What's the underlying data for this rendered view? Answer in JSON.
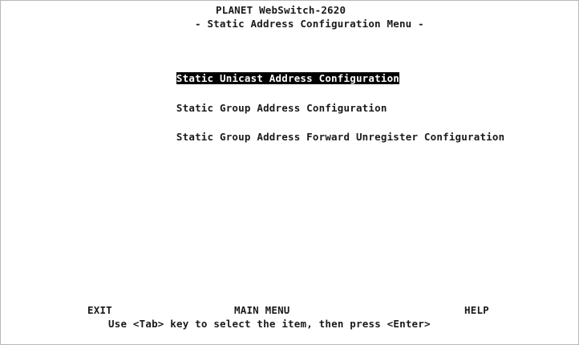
{
  "header": {
    "title": "PLANET WebSwitch-2620",
    "subtitle": "- Static Address Configuration Menu -"
  },
  "menu": {
    "items": [
      {
        "cursor_char": "S",
        "rest": "tatic Unicast Address Configuration",
        "selected": true
      },
      {
        "cursor_char": "",
        "rest": "Static Group Address Configuration",
        "selected": false
      },
      {
        "cursor_char": "",
        "rest": "Static Group Address Forward Unregister Configuration",
        "selected": false
      }
    ]
  },
  "footer": {
    "exit_label": "EXIT",
    "main_menu_label": "MAIN MENU",
    "help_label": "HELP",
    "hint": "Use <Tab> key to select the item, then press <Enter>"
  },
  "colors": {
    "background": "#ffffff",
    "text": "#1a1a1a",
    "highlight_bg": "#000000",
    "highlight_fg": "#ffffff"
  }
}
